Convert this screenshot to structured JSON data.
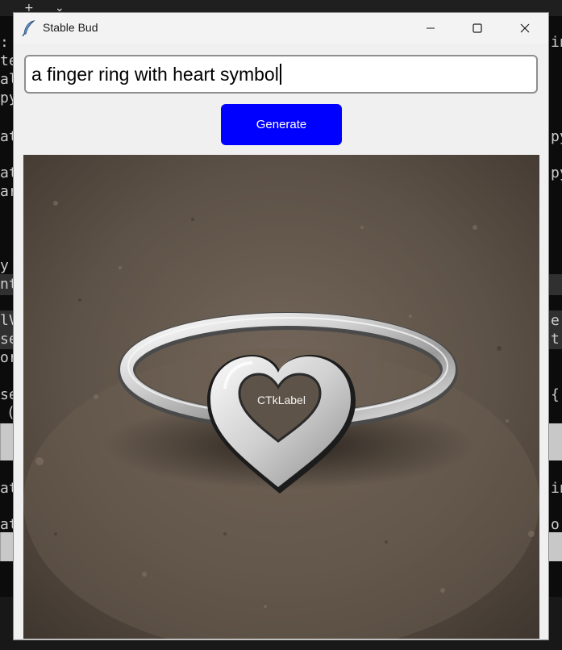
{
  "window": {
    "title": "Stable Bud",
    "controls": [
      "minimize",
      "maximize",
      "close"
    ]
  },
  "prompt": {
    "value": "a finger ring with heart symbol"
  },
  "generate_button": {
    "label": "Generate"
  },
  "image_label": {
    "text": "CTkLabel"
  },
  "icons": {
    "app": "feather-icon",
    "minimize": "minimize-icon",
    "maximize": "maximize-icon",
    "close": "close-icon",
    "new_tab": "plus-icon",
    "tab_menu": "chevron-down-icon"
  },
  "background_terminal": {
    "tab_bar": {
      "new_tab": "+",
      "menu": "⌄"
    },
    "left_fragments": [
      ":",
      "te",
      "al",
      "py",
      "at",
      "at",
      "ar",
      "y",
      "nt",
      "lV",
      "se",
      "or",
      "se",
      "(",
      "at",
      "at"
    ],
    "right_fragments": [
      "in",
      "py",
      "py",
      "er",
      "t",
      "{:",
      "in",
      "or"
    ]
  },
  "colors": {
    "generate_button": "#0000ff",
    "window_bg": "#f0f0f0",
    "terminal_bg": "#0c0c0c"
  }
}
